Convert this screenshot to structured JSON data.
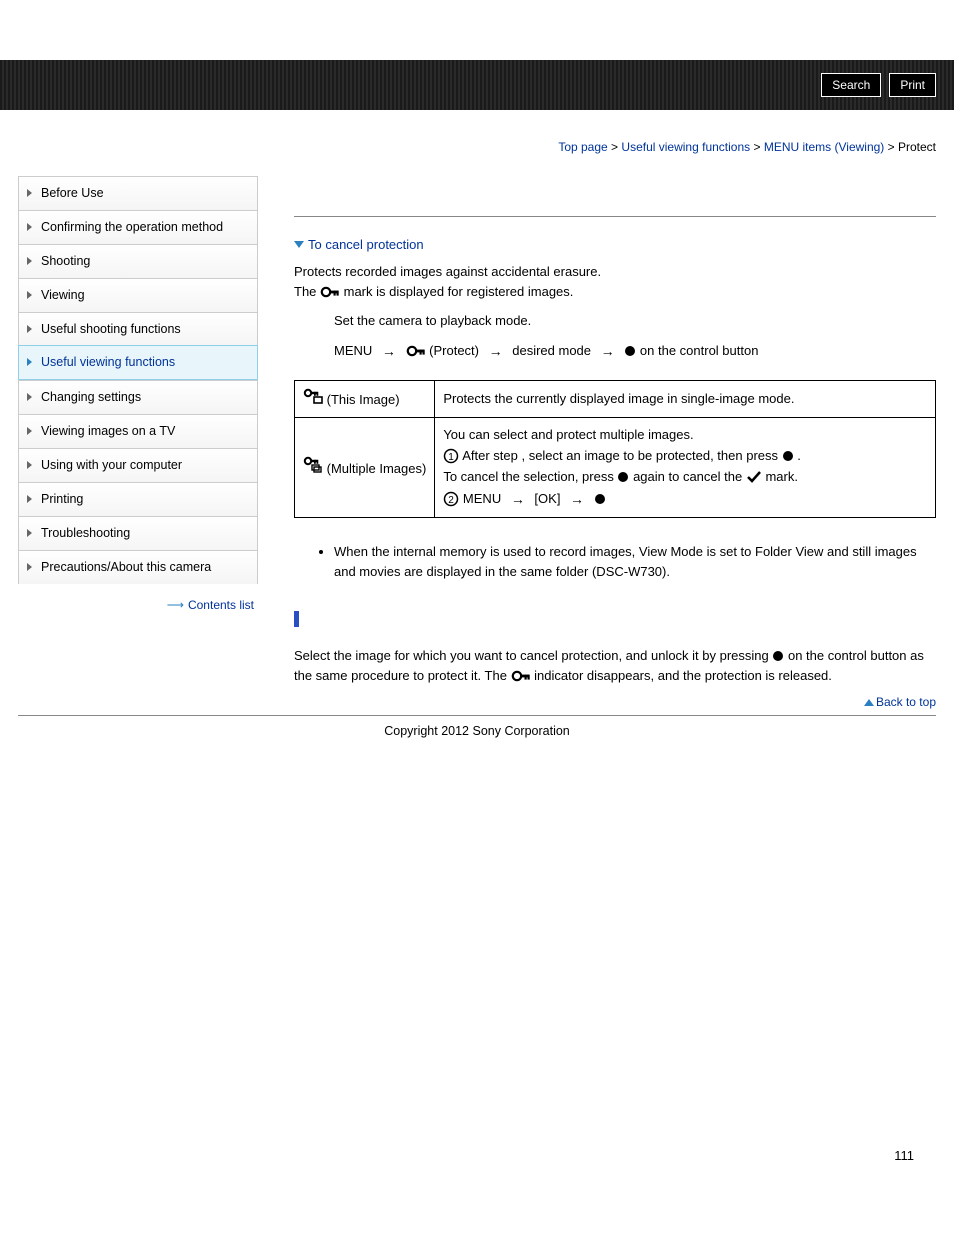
{
  "header": {
    "search_label": "Search",
    "print_label": "Print"
  },
  "breadcrumb": {
    "top": "Top page",
    "sec1": "Useful viewing functions",
    "sec2": "MENU items (Viewing)",
    "current": "Protect"
  },
  "sidebar": {
    "items": [
      {
        "label": "Before Use"
      },
      {
        "label": "Confirming the operation method"
      },
      {
        "label": "Shooting"
      },
      {
        "label": "Viewing"
      },
      {
        "label": "Useful shooting functions"
      },
      {
        "label": "Useful viewing functions"
      },
      {
        "label": "Changing settings"
      },
      {
        "label": "Viewing images on a TV"
      },
      {
        "label": "Using with your computer"
      },
      {
        "label": "Printing"
      },
      {
        "label": "Troubleshooting"
      },
      {
        "label": "Precautions/About this camera"
      }
    ],
    "contents_list": "Contents list"
  },
  "content": {
    "jump_cancel": "To cancel protection",
    "intro1": "Protects recorded images against accidental erasure.",
    "intro2a": "The ",
    "intro2b": " mark is displayed for registered images.",
    "step1": "Set the camera to playback mode.",
    "step2": {
      "menu": "MENU",
      "protect": " (Protect)",
      "desired": "desired mode",
      "tail": " on the control button"
    },
    "table": {
      "r1": {
        "label": " (This Image)",
        "desc": "Protects the currently displayed image in single-image mode."
      },
      "r2": {
        "label": " (Multiple Images)",
        "line1": "You can select and protect multiple images.",
        "line2a": " After step ",
        "line2b": ", select an image to be protected, then press ",
        "line2c": " .",
        "line3a": "To cancel the selection, press ",
        "line3b": " again to cancel the ",
        "line3c": " mark.",
        "line4a": " MENU ",
        "line4b": " [OK] ",
        "line4c": ""
      }
    },
    "note1": "When the internal memory is used to record images, View Mode is set to Folder View and still images and movies are displayed in the same folder (DSC-W730).",
    "cancel_text_a": "Select the image for which you want to cancel protection, and unlock it by pressing ",
    "cancel_text_b": " on the control button as the same procedure to protect it. The ",
    "cancel_text_c": " indicator disappears, and the protection is released.",
    "back_top": "Back to top"
  },
  "footer": {
    "copyright": "Copyright 2012 Sony Corporation",
    "page": "111"
  }
}
